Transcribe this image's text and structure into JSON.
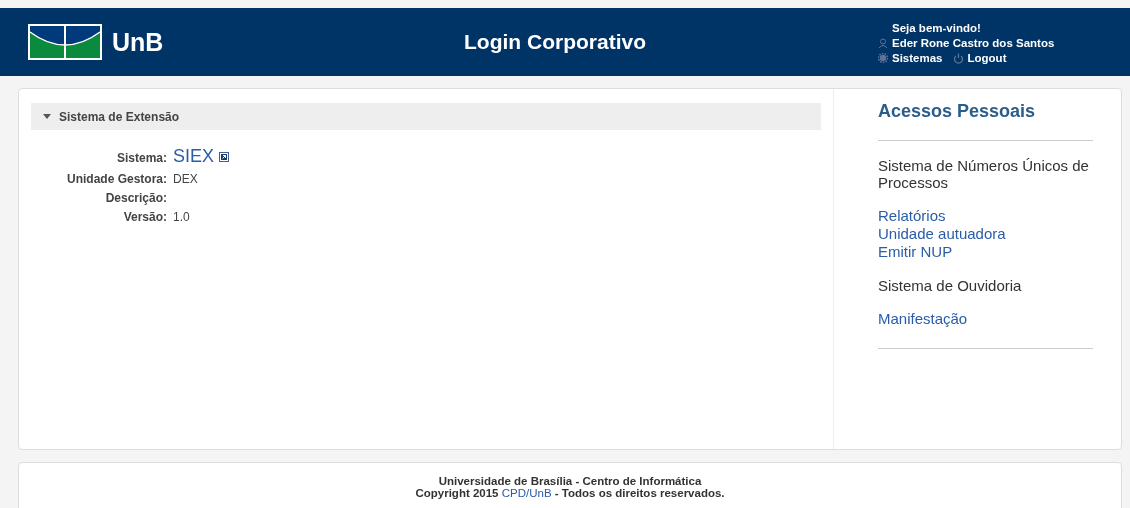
{
  "header": {
    "logo_text": "UnB",
    "title": "Login Corporativo",
    "welcome": "Seja bem-vindo!",
    "user_name": "Eder Rone Castro dos Santos",
    "systems_link": "Sistemas",
    "logout_link": "Logout"
  },
  "section": {
    "title": "Sistema de Extensão",
    "expanded": true,
    "fields": [
      {
        "label": "Sistema:",
        "value": "SIEX",
        "kind": "link"
      },
      {
        "label": "Unidade Gestora:",
        "value": "DEX",
        "kind": "text"
      },
      {
        "label": "Descrição:"
      },
      {
        "label": "Versão:",
        "value": "1.0",
        "kind": "text"
      }
    ]
  },
  "sidebar": {
    "title": "Acessos Pessoais",
    "groups": [
      {
        "heading": "Sistema de Números Únicos de Processos",
        "links": [
          "Relatórios",
          "Unidade autuadora",
          "Emitir NUP"
        ]
      },
      {
        "heading": "Sistema de Ouvidoria",
        "links": [
          "Manifestação"
        ]
      }
    ]
  },
  "footer": {
    "line1": "Universidade de Brasília - Centro de Informática",
    "line2_before": "Copyright 2015",
    "line2_link": "CPD/UnB",
    "line2_after": "- Todos os direitos reservados."
  }
}
